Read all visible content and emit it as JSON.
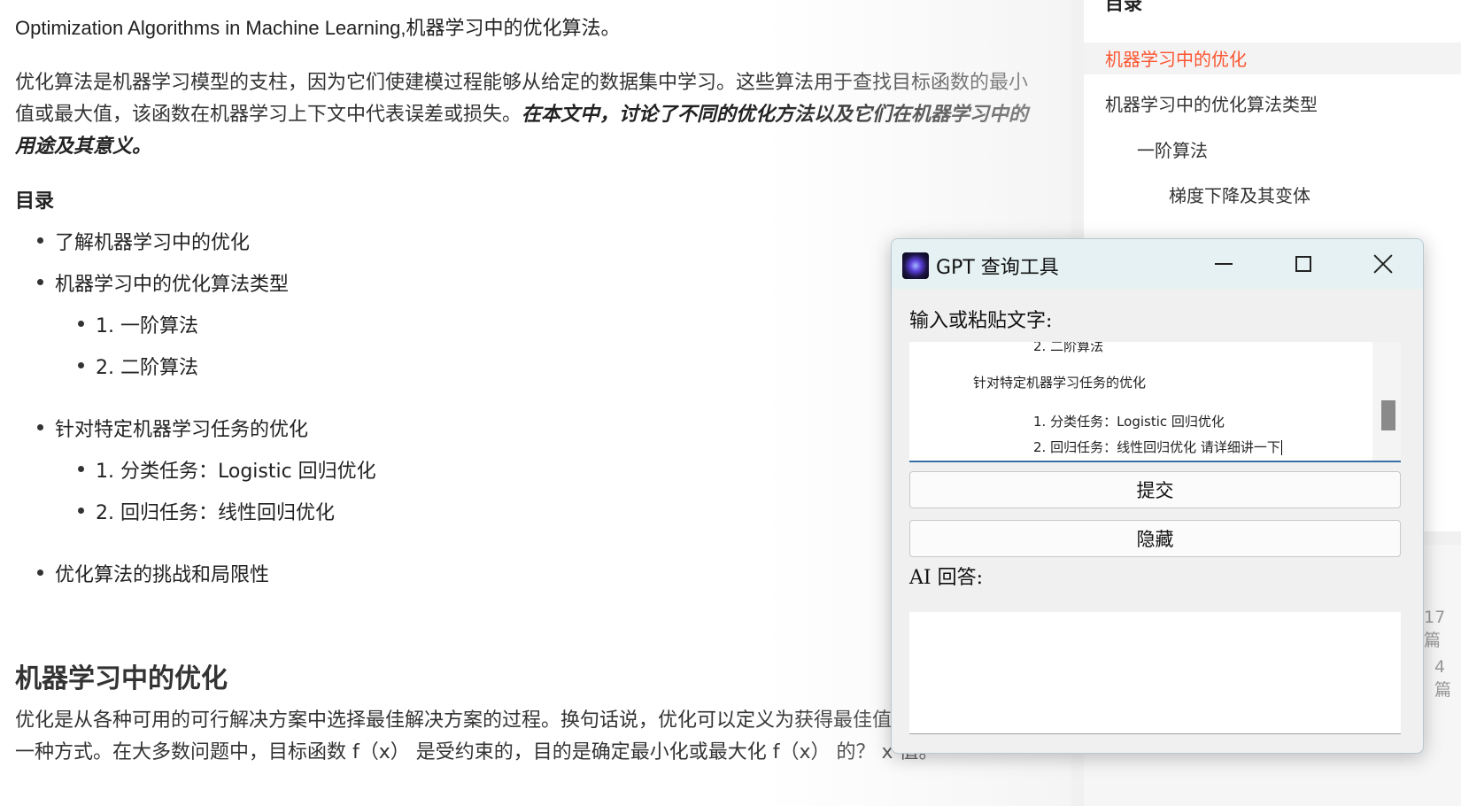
{
  "article": {
    "intro_line": "Optimization Algorithms in Machine Learning,机器学习中的优化算法。",
    "paragraph": "优化算法是机器学习模型的支柱，因为它们使建模过程能够从给定的数据集中学习。这些算法用于查找目标函数的最小值或最大值，该函数在机器学习上下文中代表误差或损失。",
    "paragraph_emphasis": "在本文中，讨论了不同的优化方法以及它们在机器学习中的用途及其意义。",
    "toc_title": "目录",
    "toc": [
      "了解机器学习中的优化",
      "机器学习中的优化算法类型",
      "1. 一阶算法",
      "2. 二阶算法",
      "针对特定机器学习任务的优化",
      "1. 分类任务：Logistic 回归优化",
      "2. 回归任务：线性回归优化",
      "优化算法的挑战和局限性"
    ],
    "section_heading": "机器学习中的优化",
    "section_paragraph": "优化是从各种可用的可行解决方案中选择最佳解决方案的过程。换句话说，优化可以定义为获得最佳值或最小值的一种方式。在大多数问题中，目标函数 f（x） 是受约束的，目的是确定最小化或最大化 f（x） 的？ x 值。"
  },
  "sidebar": {
    "toc_head": "目录",
    "items": [
      "机器学习中的优化",
      "机器学习中的优化算法类型",
      "一阶算法",
      "梯度下降及其变体"
    ],
    "counts": [
      "17篇",
      "4篇"
    ]
  },
  "dialog": {
    "title": "GPT 查询工具",
    "input_label": "输入或粘贴文字:",
    "input_lines": [
      "2. 二阶算法",
      "针对特定机器学习任务的优化",
      "1. 分类任务：Logistic 回归优化",
      "2. 回归任务：线性回归优化 请详细讲一下"
    ],
    "submit_label": "提交",
    "hide_label": "隐藏",
    "answer_label": "AI 回答:",
    "answer_text": ""
  },
  "colors": {
    "toc_active": "#fc5531",
    "titlebar": "#e5f1f2",
    "input_focus_border": "#3a6ea8"
  }
}
